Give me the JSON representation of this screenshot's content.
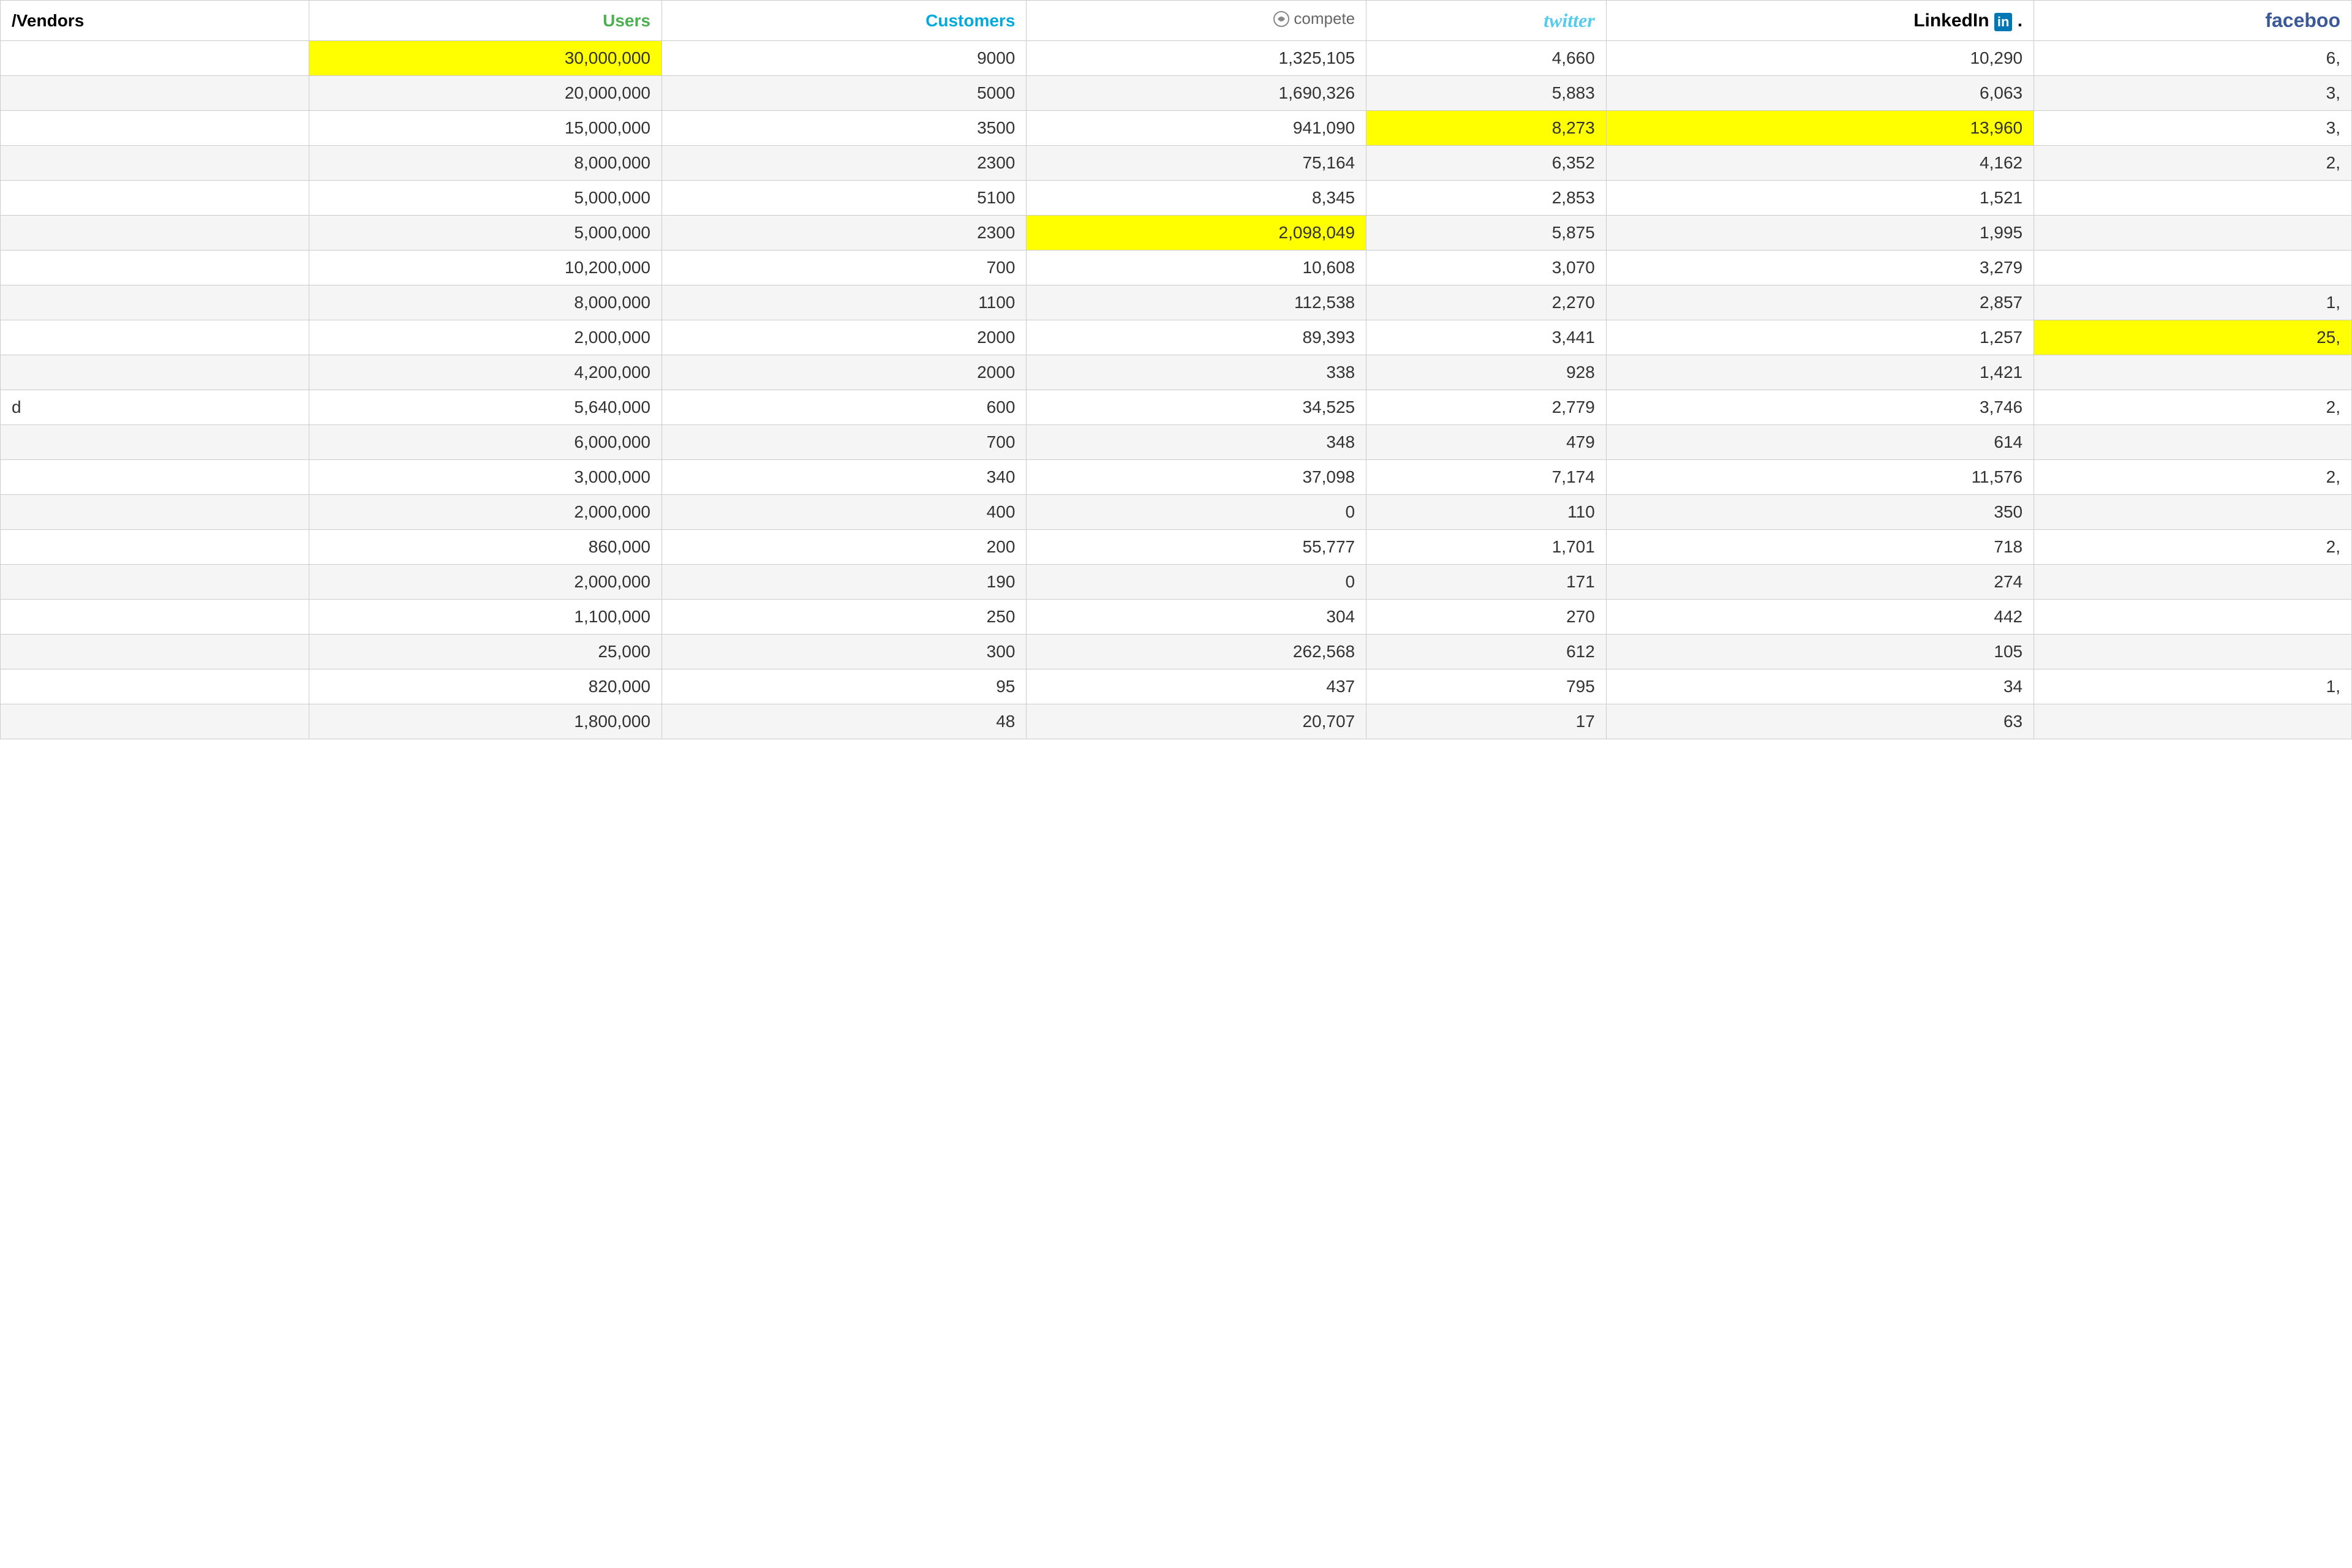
{
  "headers": {
    "vendors": "/Vendors",
    "users": "Users",
    "customers": "Customers",
    "compete": "compete",
    "twitter": "twitter",
    "linkedin": "LinkedIn",
    "facebook": "faceboo"
  },
  "rows": [
    {
      "vendor": "",
      "users": "30,000,000",
      "customers": "9000",
      "compete": "1,325,105",
      "twitter": "4,660",
      "linkedin": "10,290",
      "facebook": "6,",
      "highlight_users": true,
      "highlight_customers": false,
      "highlight_compete": false,
      "highlight_twitter": false,
      "highlight_linkedin": false,
      "highlight_facebook": false
    },
    {
      "vendor": "",
      "users": "20,000,000",
      "customers": "5000",
      "compete": "1,690,326",
      "twitter": "5,883",
      "linkedin": "6,063",
      "facebook": "3,",
      "highlight_users": false,
      "highlight_customers": false,
      "highlight_compete": false,
      "highlight_twitter": false,
      "highlight_linkedin": false,
      "highlight_facebook": false
    },
    {
      "vendor": "",
      "users": "15,000,000",
      "customers": "3500",
      "compete": "941,090",
      "twitter": "8,273",
      "linkedin": "13,960",
      "facebook": "3,",
      "highlight_users": false,
      "highlight_customers": false,
      "highlight_compete": false,
      "highlight_twitter": true,
      "highlight_linkedin": true,
      "highlight_facebook": false
    },
    {
      "vendor": "",
      "users": "8,000,000",
      "customers": "2300",
      "compete": "75,164",
      "twitter": "6,352",
      "linkedin": "4,162",
      "facebook": "2,",
      "highlight_users": false,
      "highlight_customers": false,
      "highlight_compete": false,
      "highlight_twitter": false,
      "highlight_linkedin": false,
      "highlight_facebook": false
    },
    {
      "vendor": "",
      "users": "5,000,000",
      "customers": "5100",
      "compete": "8,345",
      "twitter": "2,853",
      "linkedin": "1,521",
      "facebook": "",
      "highlight_users": false,
      "highlight_customers": false,
      "highlight_compete": false,
      "highlight_twitter": false,
      "highlight_linkedin": false,
      "highlight_facebook": false
    },
    {
      "vendor": "",
      "users": "5,000,000",
      "customers": "2300",
      "compete": "2,098,049",
      "twitter": "5,875",
      "linkedin": "1,995",
      "facebook": "",
      "highlight_users": false,
      "highlight_customers": false,
      "highlight_compete": true,
      "highlight_twitter": false,
      "highlight_linkedin": false,
      "highlight_facebook": false
    },
    {
      "vendor": "",
      "users": "10,200,000",
      "customers": "700",
      "compete": "10,608",
      "twitter": "3,070",
      "linkedin": "3,279",
      "facebook": "",
      "highlight_users": false,
      "highlight_customers": false,
      "highlight_compete": false,
      "highlight_twitter": false,
      "highlight_linkedin": false,
      "highlight_facebook": false
    },
    {
      "vendor": "",
      "users": "8,000,000",
      "customers": "1100",
      "compete": "112,538",
      "twitter": "2,270",
      "linkedin": "2,857",
      "facebook": "1,",
      "highlight_users": false,
      "highlight_customers": false,
      "highlight_compete": false,
      "highlight_twitter": false,
      "highlight_linkedin": false,
      "highlight_facebook": false
    },
    {
      "vendor": "",
      "users": "2,000,000",
      "customers": "2000",
      "compete": "89,393",
      "twitter": "3,441",
      "linkedin": "1,257",
      "facebook": "25,",
      "highlight_users": false,
      "highlight_customers": false,
      "highlight_compete": false,
      "highlight_twitter": false,
      "highlight_linkedin": false,
      "highlight_facebook": true
    },
    {
      "vendor": "",
      "users": "4,200,000",
      "customers": "2000",
      "compete": "338",
      "twitter": "928",
      "linkedin": "1,421",
      "facebook": "",
      "highlight_users": false,
      "highlight_customers": false,
      "highlight_compete": false,
      "highlight_twitter": false,
      "highlight_linkedin": false,
      "highlight_facebook": false
    },
    {
      "vendor": "d",
      "users": "5,640,000",
      "customers": "600",
      "compete": "34,525",
      "twitter": "2,779",
      "linkedin": "3,746",
      "facebook": "2,",
      "highlight_users": false,
      "highlight_customers": false,
      "highlight_compete": false,
      "highlight_twitter": false,
      "highlight_linkedin": false,
      "highlight_facebook": false
    },
    {
      "vendor": "",
      "users": "6,000,000",
      "customers": "700",
      "compete": "348",
      "twitter": "479",
      "linkedin": "614",
      "facebook": "",
      "highlight_users": false,
      "highlight_customers": false,
      "highlight_compete": false,
      "highlight_twitter": false,
      "highlight_linkedin": false,
      "highlight_facebook": false
    },
    {
      "vendor": "",
      "users": "3,000,000",
      "customers": "340",
      "compete": "37,098",
      "twitter": "7,174",
      "linkedin": "11,576",
      "facebook": "2,",
      "highlight_users": false,
      "highlight_customers": false,
      "highlight_compete": false,
      "highlight_twitter": false,
      "highlight_linkedin": false,
      "highlight_facebook": false
    },
    {
      "vendor": "",
      "users": "2,000,000",
      "customers": "400",
      "compete": "0",
      "twitter": "110",
      "linkedin": "350",
      "facebook": "",
      "highlight_users": false,
      "highlight_customers": false,
      "highlight_compete": false,
      "highlight_twitter": false,
      "highlight_linkedin": false,
      "highlight_facebook": false
    },
    {
      "vendor": "",
      "users": "860,000",
      "customers": "200",
      "compete": "55,777",
      "twitter": "1,701",
      "linkedin": "718",
      "facebook": "2,",
      "highlight_users": false,
      "highlight_customers": false,
      "highlight_compete": false,
      "highlight_twitter": false,
      "highlight_linkedin": false,
      "highlight_facebook": false
    },
    {
      "vendor": "",
      "users": "2,000,000",
      "customers": "190",
      "compete": "0",
      "twitter": "171",
      "linkedin": "274",
      "facebook": "",
      "highlight_users": false,
      "highlight_customers": false,
      "highlight_compete": false,
      "highlight_twitter": false,
      "highlight_linkedin": false,
      "highlight_facebook": false
    },
    {
      "vendor": "",
      "users": "1,100,000",
      "customers": "250",
      "compete": "304",
      "twitter": "270",
      "linkedin": "442",
      "facebook": "",
      "highlight_users": false,
      "highlight_customers": false,
      "highlight_compete": false,
      "highlight_twitter": false,
      "highlight_linkedin": false,
      "highlight_facebook": false
    },
    {
      "vendor": "",
      "users": "25,000",
      "customers": "300",
      "compete": "262,568",
      "twitter": "612",
      "linkedin": "105",
      "facebook": "",
      "highlight_users": false,
      "highlight_customers": false,
      "highlight_compete": false,
      "highlight_twitter": false,
      "highlight_linkedin": false,
      "highlight_facebook": false
    },
    {
      "vendor": "",
      "users": "820,000",
      "customers": "95",
      "compete": "437",
      "twitter": "795",
      "linkedin": "34",
      "facebook": "1,",
      "highlight_users": false,
      "highlight_customers": false,
      "highlight_compete": false,
      "highlight_twitter": false,
      "highlight_linkedin": false,
      "highlight_facebook": false
    },
    {
      "vendor": "",
      "users": "1,800,000",
      "customers": "48",
      "compete": "20,707",
      "twitter": "17",
      "linkedin": "63",
      "facebook": "",
      "highlight_users": false,
      "highlight_customers": false,
      "highlight_compete": false,
      "highlight_twitter": false,
      "highlight_linkedin": false,
      "highlight_facebook": false
    }
  ]
}
